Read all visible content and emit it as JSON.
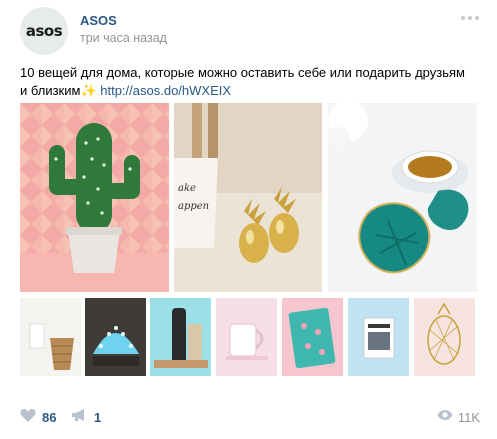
{
  "post": {
    "avatar_text": "asos",
    "author": "ASOS",
    "time": "три часа назад",
    "text_before": "10 вещей для дома, которые можно оставить себе или подарить друзьям и близким",
    "sparkle": "✨",
    "link": "http://asos.do/hWXEIX"
  },
  "photos": [
    "cactus-lamp",
    "gold-pineapple-salt-pepper",
    "monstera-leaf-coasters"
  ],
  "thumbs": [
    "wicker-baskets",
    "shell-light",
    "kitchen-bottle-set",
    "mug",
    "flamingo-notebook",
    "book",
    "pineapple-wire-frame"
  ],
  "footer": {
    "likes": "86",
    "shares": "1",
    "views": "11K"
  },
  "colors": {
    "link": "#2a5885",
    "meta": "#939393",
    "icon": "#b9c2cc"
  }
}
